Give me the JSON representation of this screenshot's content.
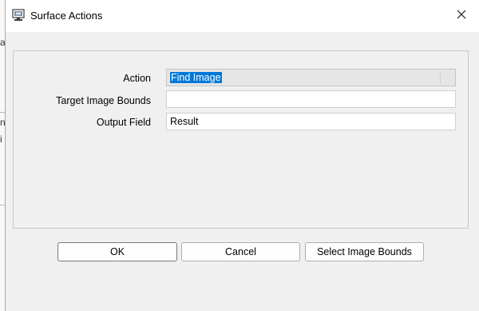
{
  "background_window": {
    "glyphs": [
      "a",
      "n",
      "i"
    ]
  },
  "dialog": {
    "title": "Surface Actions",
    "icons": {
      "app": "monitor-icon",
      "close": "close-icon"
    }
  },
  "form": {
    "action": {
      "label": "Action",
      "value": "Find Image"
    },
    "target_bounds": {
      "label": "Target Image Bounds",
      "value": ""
    },
    "output_field": {
      "label": "Output Field",
      "value": "Result"
    }
  },
  "buttons": {
    "ok": "OK",
    "cancel": "Cancel",
    "select_bounds": "Select Image Bounds"
  },
  "colors": {
    "selection": "#0078d7",
    "dialog_bg": "#f0f0f0",
    "titlebar_bg": "#ffffff"
  }
}
